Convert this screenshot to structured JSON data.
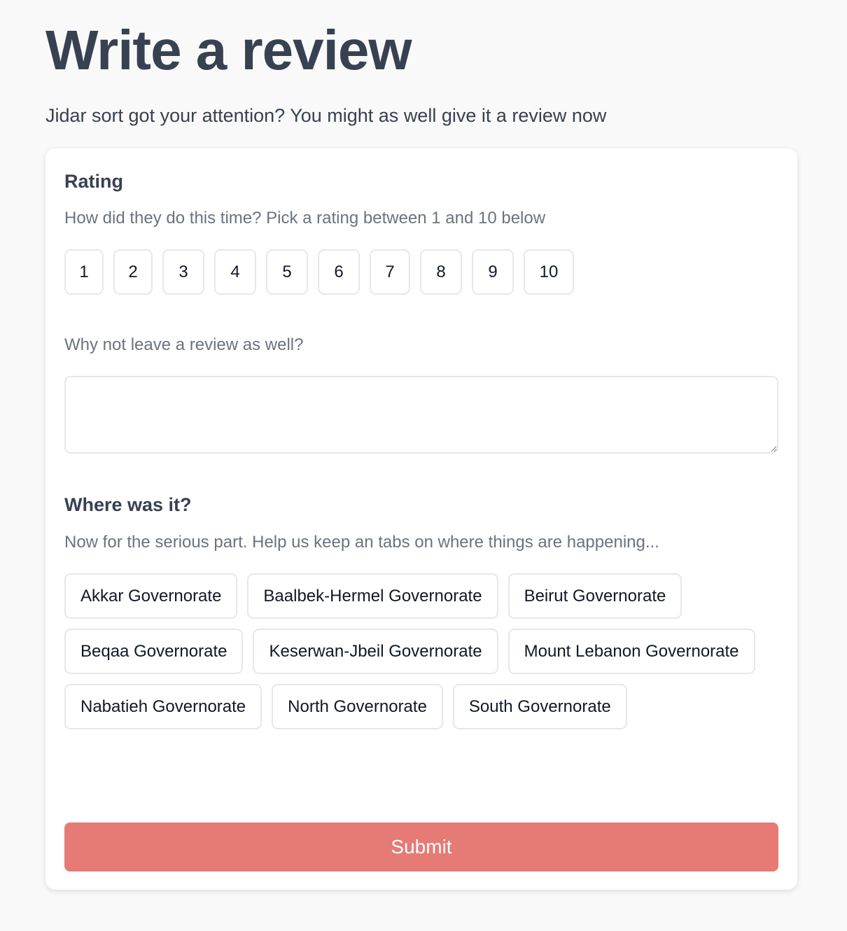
{
  "header": {
    "title": "Write a review",
    "subtitle": "Jidar sort got your attention? You might as well give it a review now"
  },
  "rating": {
    "title": "Rating",
    "description": "How did they do this time? Pick a rating between 1 and 10 below",
    "options": [
      "1",
      "2",
      "3",
      "4",
      "5",
      "6",
      "7",
      "8",
      "9",
      "10"
    ]
  },
  "review": {
    "prompt": "Why not leave a review as well?",
    "value": "",
    "placeholder": ""
  },
  "location": {
    "title": "Where was it?",
    "description": "Now for the serious part. Help us keep an tabs on where things are happening...",
    "options": [
      "Akkar Governorate",
      "Baalbek-Hermel Governorate",
      "Beirut Governorate",
      "Beqaa Governorate",
      "Keserwan-Jbeil Governorate",
      "Mount Lebanon Governorate",
      "Nabatieh Governorate",
      "North Governorate",
      "South Governorate"
    ]
  },
  "submit": {
    "label": "Submit"
  },
  "colors": {
    "accent": "#e67a75",
    "heading": "#374151",
    "muted": "#6b7280",
    "border": "#e5e7eb",
    "background": "#f9f9f9"
  }
}
